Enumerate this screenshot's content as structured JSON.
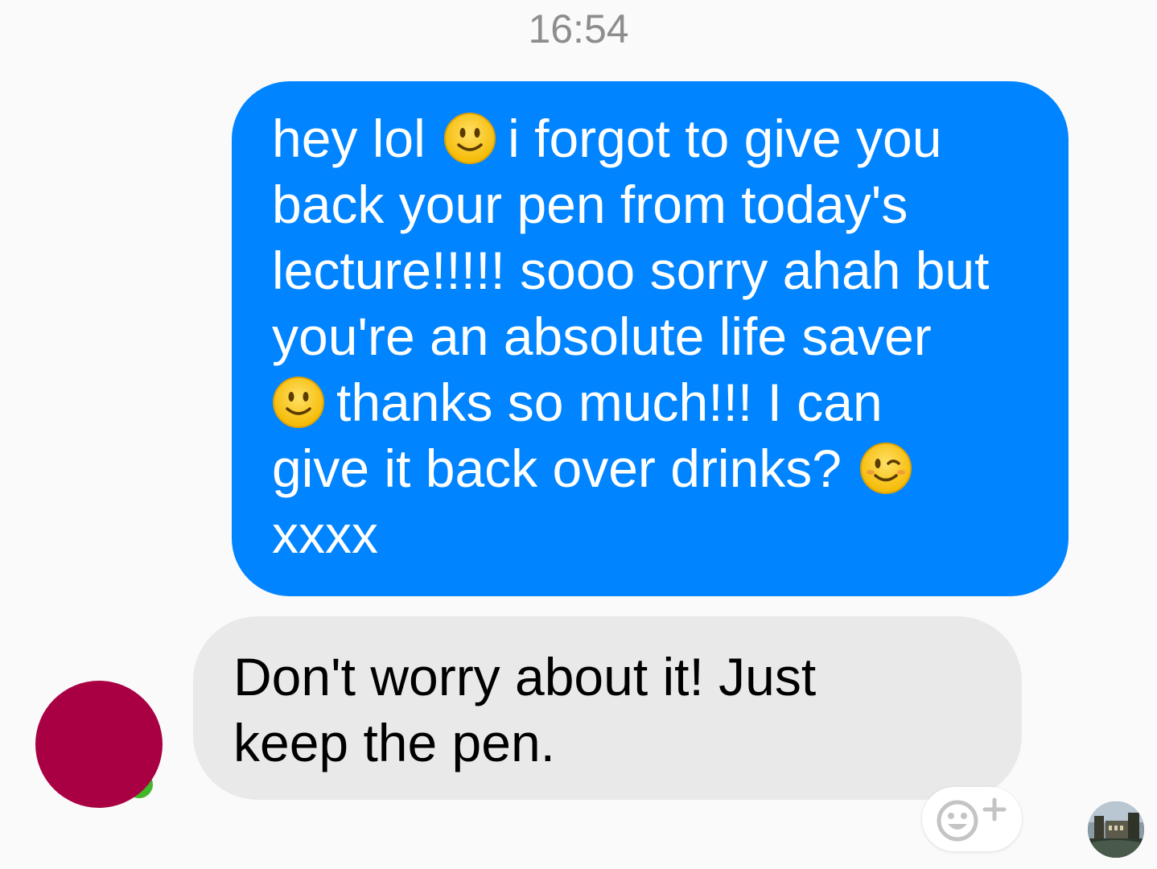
{
  "conversation": {
    "timestamp": "16:54",
    "outgoing_message": {
      "lines": [
        {
          "before": "hey lol",
          "emoji": "slightly-smiling-face",
          "after": "i forgot to give you"
        },
        {
          "text": "back your pen from today's"
        },
        {
          "text": "lecture!!!!! sooo sorry ahah but"
        },
        {
          "text": "you're an absolute life saver"
        },
        {
          "emoji": "slightly-smiling-face",
          "after": "thanks so much!!! I can"
        },
        {
          "before": "give it back over drinks?",
          "emoji": "winking-face"
        },
        {
          "text": "xxxx"
        }
      ]
    },
    "incoming_message": {
      "lines": [
        "Don't worry about it! Just",
        "keep the pen."
      ]
    }
  },
  "icons": {
    "react": "add-reaction-icon",
    "emoji_smile": "slightly-smiling-face",
    "emoji_wink": "winking-face"
  },
  "colors": {
    "outgoing_bubble": "#0084ff",
    "incoming_bubble": "#e9e9e9",
    "avatar": "#a80042",
    "presence": "#42b72a"
  }
}
